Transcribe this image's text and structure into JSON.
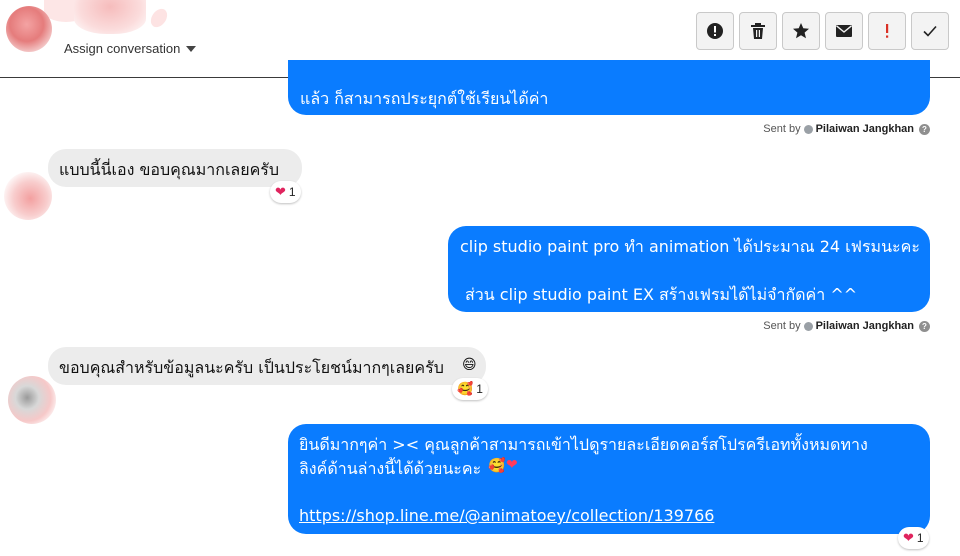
{
  "header": {
    "assign_label": "Assign conversation",
    "toolbar": [
      {
        "name": "spam-button",
        "icon": "exclamation-circle-icon"
      },
      {
        "name": "delete-button",
        "icon": "trash-icon"
      },
      {
        "name": "star-button",
        "icon": "star-icon"
      },
      {
        "name": "mark-unread-button",
        "icon": "envelope-icon"
      },
      {
        "name": "follow-up-button",
        "icon": "exclamation-icon"
      },
      {
        "name": "done-button",
        "icon": "check-icon"
      }
    ]
  },
  "messages": {
    "m1": {
      "line1": "แล้ว ก็สามารถประยุกต์ใช้เรียนได้ค่า"
    },
    "sent1": {
      "prefix": "Sent by",
      "name": "Pilaiwan Jangkhan"
    },
    "m2": {
      "text": "แบบนี้นี่เอง ขอบคุณมากเลยครับ",
      "reaction_count": "1"
    },
    "m3": {
      "line1": "clip studio paint pro ทำ animation ได้ประมาณ 24 เฟรมนะคะ",
      "line2": "ส่วน clip studio paint EX สร้างเฟรมได้ไม่จำกัดค่า ^^"
    },
    "sent2": {
      "prefix": "Sent by",
      "name": "Pilaiwan Jangkhan"
    },
    "m4": {
      "text": "ขอบคุณสำหรับข้อมูลนะครับ เป็นประโยชน์มากๆเลยครับ",
      "reaction_count": "1"
    },
    "m5": {
      "line1": "ยินดีมากๆค่า >< คุณลูกค้าสามารถเข้าไปดูรายละเอียดคอร์สโปรครีเอททั้งหมดทาง",
      "line2": "ลิงค์ด้านล่างนี้ได้ด้วยนะคะ",
      "link": "https://shop.line.me/@animatoey/collection/139766",
      "reaction_count": "1"
    }
  },
  "colors": {
    "outgoing": "#0a7cff",
    "incoming": "#ececec"
  }
}
